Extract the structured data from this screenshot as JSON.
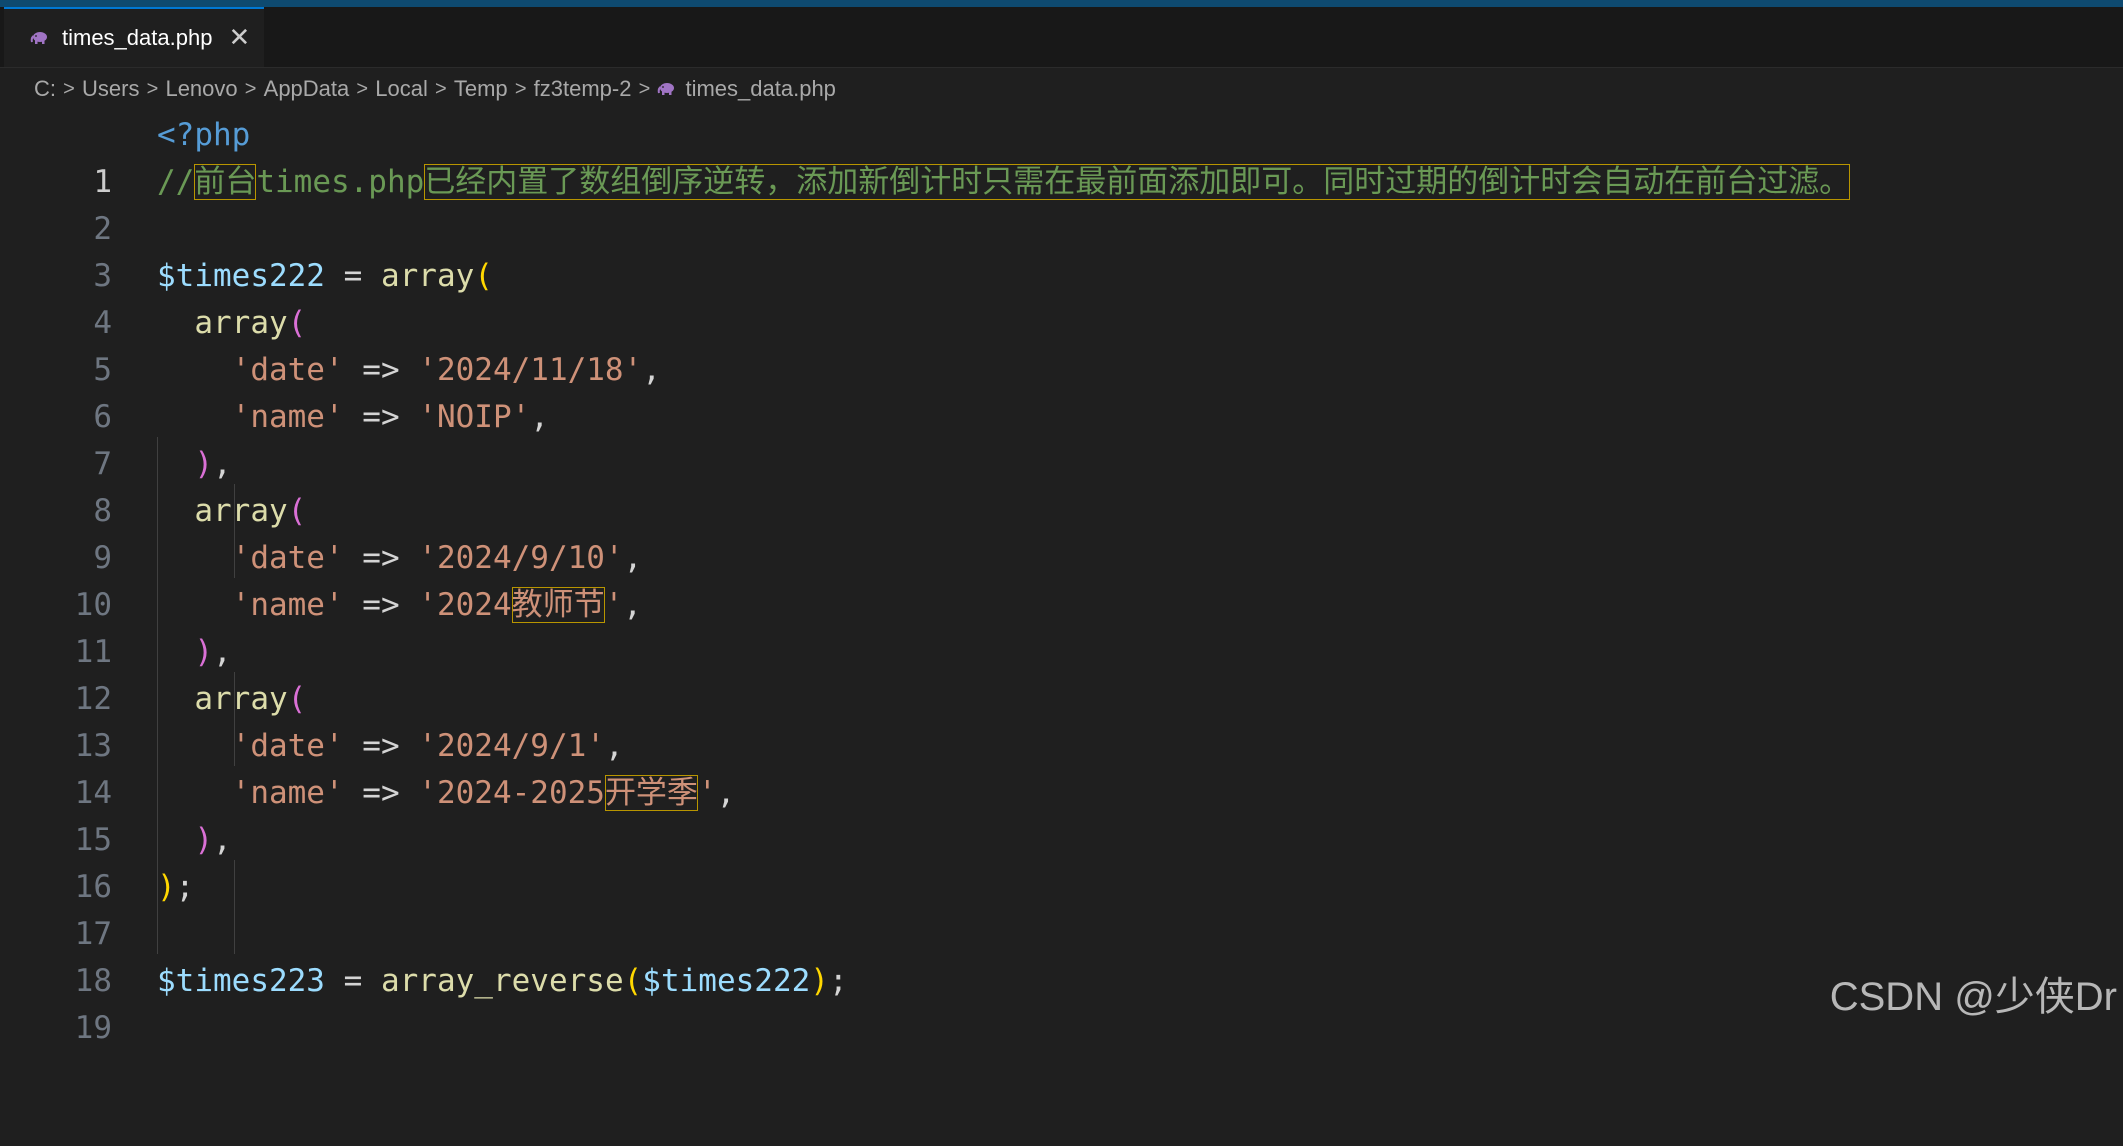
{
  "tab": {
    "label": "times_data.php",
    "file_icon": "php-elephant-icon",
    "close_glyph": "✕"
  },
  "breadcrumb": {
    "items": [
      "C:",
      "Users",
      "Lenovo",
      "AppData",
      "Local",
      "Temp",
      "fz3temp-2",
      "times_data.php"
    ],
    "separator": ">"
  },
  "editor": {
    "active_line": 1,
    "line_numbers": [
      "1",
      "2",
      "3",
      "4",
      "5",
      "6",
      "7",
      "8",
      "9",
      "10",
      "11",
      "12",
      "13",
      "14",
      "15",
      "16",
      "17",
      "18",
      "19"
    ],
    "code": {
      "l1_open_tag": "<?php",
      "l2_slashes": "//",
      "l2_cjk_a": "前台",
      "l2_file": "times.php",
      "l2_cjk_b": "已经内置了数组倒序逆转，添加新倒计时只需在最前面添加即可。同时过期的倒计时会自动在前台过滤。",
      "var_a": "$times222",
      "var_b": "$times223",
      "eq": " = ",
      "fn_array": "array",
      "fn_reverse": "array_reverse",
      "open_paren": "(",
      "close_paren": ")",
      "comma": ",",
      "semicolon": ";",
      "arrow": " => ",
      "key_date": "'date'",
      "key_name": "'name'",
      "entry1_date": "'2024/11/18'",
      "entry1_name": "'NOIP'",
      "entry2_date": "'2024/9/10'",
      "entry2_name_a": "'2024",
      "entry2_name_cjk": "教师节",
      "entry2_name_b": "'",
      "entry3_date": "'2024/9/1'",
      "entry3_name_a": "'2024-2025",
      "entry3_name_cjk": "开学季",
      "entry3_name_b": "'"
    }
  },
  "watermark": "CSDN @少侠Dr",
  "colors": {
    "background": "#1f1f1f",
    "keyword": "#569cd6",
    "comment": "#6a9955",
    "variable": "#9cdcfe",
    "function": "#dcdcaa",
    "string": "#ce9178",
    "bracket_level1": "#ffd700",
    "bracket_level2": "#da70d6",
    "unicode_highlight_border": "#b89500"
  }
}
